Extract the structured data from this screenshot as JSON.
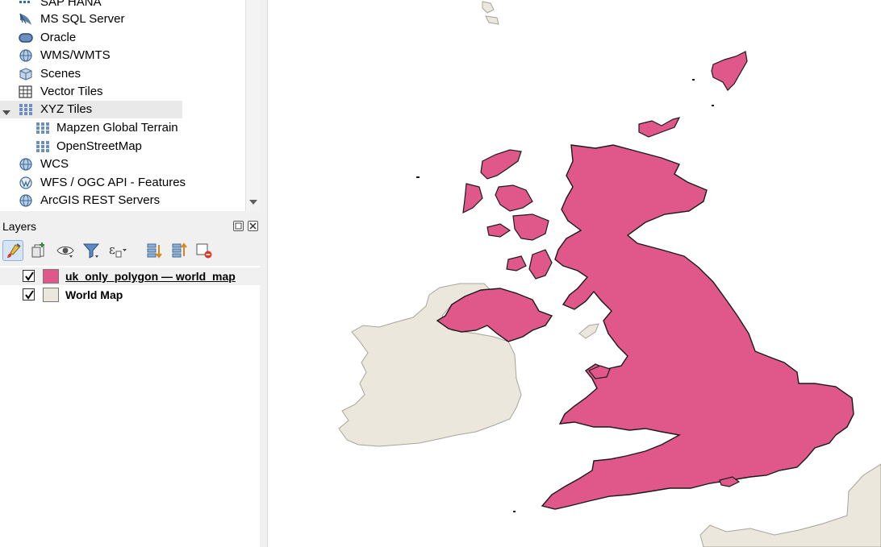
{
  "browser": {
    "items": [
      {
        "label": "SAP HANA",
        "icon": "sap-hana-icon"
      },
      {
        "label": "MS SQL Server",
        "icon": "mssql-icon"
      },
      {
        "label": "Oracle",
        "icon": "oracle-icon"
      },
      {
        "label": "WMS/WMTS",
        "icon": "globe-icon"
      },
      {
        "label": "Scenes",
        "icon": "cube-icon"
      },
      {
        "label": "Vector Tiles",
        "icon": "grid-icon"
      },
      {
        "label": "XYZ Tiles",
        "icon": "grid-icon",
        "expanded": true,
        "selected": true
      },
      {
        "label": "Mapzen Global Terrain",
        "icon": "tiles-icon",
        "child": true
      },
      {
        "label": "OpenStreetMap",
        "icon": "tiles-icon",
        "child": true
      },
      {
        "label": "WCS",
        "icon": "globe-icon"
      },
      {
        "label": "WFS / OGC API - Features",
        "icon": "wfs-icon"
      },
      {
        "label": "ArcGIS REST Servers",
        "icon": "globe-icon"
      }
    ]
  },
  "layers_panel": {
    "title": "Layers",
    "toolbar": [
      "style-brush-icon",
      "add-group-icon",
      "visibility-eye-icon",
      "filter-legend-icon",
      "expression-filter-icon",
      "expand-all-icon",
      "collapse-all-icon",
      "remove-layer-icon"
    ],
    "layers": [
      {
        "name": "uk_only_polygon — world_map",
        "checked": true,
        "color": "#e0578a",
        "selected": true
      },
      {
        "name": "World Map",
        "checked": true,
        "color": "#ebe7dc"
      }
    ]
  },
  "map": {
    "background": "#ffffff",
    "uk_fill": "#e0578a",
    "uk_stroke": "#1a1a1a",
    "land_fill": "#ebe7dc",
    "land_stroke": "#a8a49a"
  }
}
